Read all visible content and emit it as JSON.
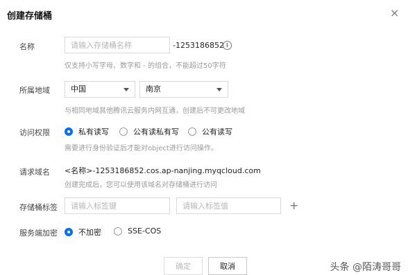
{
  "dialog": {
    "title": "创建存储桶",
    "close_icon": "×"
  },
  "name": {
    "label": "名称",
    "placeholder": "请输入存储桶名称",
    "suffix": "-1253186852",
    "info_icon": "i",
    "hint": "仅支持小写字母、数字和 - 的组合，不能超过50字符"
  },
  "region": {
    "label": "所属地域",
    "country": "中国",
    "city": "南京",
    "hint": "与相同地域其他腾讯云服务内网互通，创建后不可更改地域"
  },
  "access": {
    "label": "访问权限",
    "options": [
      "私有读写",
      "公有读私有写",
      "公有读写"
    ],
    "selected": "私有读写",
    "hint": "需要进行身份验证后才能对object进行访问操作。"
  },
  "domain": {
    "label": "请求域名",
    "value": "<名称>-1253186852.cos.ap-nanjing.myqcloud.com",
    "hint": "创建完成后，您可以使用该域名对存储桶进行访问"
  },
  "tags": {
    "label": "存储桶标签",
    "key_placeholder": "请输入标签键",
    "value_placeholder": "请输入标签值",
    "add_icon": "+"
  },
  "encryption": {
    "label": "服务端加密",
    "options": [
      "不加密",
      "SSE-COS"
    ],
    "selected": "不加密"
  },
  "footer": {
    "confirm_label": "确定",
    "cancel_label": "取消"
  },
  "watermark": "头条 @陌涛哥哥",
  "colors": {
    "accent": "#006eff"
  }
}
